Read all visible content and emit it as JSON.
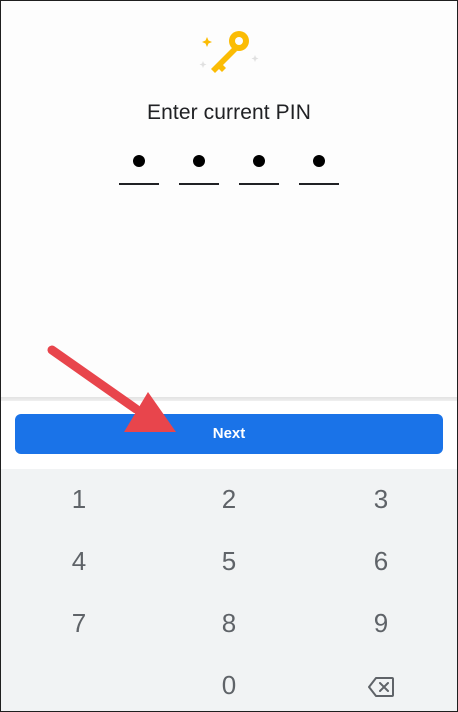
{
  "screen": {
    "title": "Enter current PIN",
    "pin_digits": [
      "●",
      "●",
      "●",
      "●"
    ]
  },
  "next_button": {
    "label": "Next"
  },
  "keypad": {
    "keys": [
      "1",
      "2",
      "3",
      "4",
      "5",
      "6",
      "7",
      "8",
      "9",
      "0"
    ],
    "backspace_icon": "backspace-icon"
  },
  "colors": {
    "accent": "#1a73e8",
    "key_icon": "#fbbc04",
    "annotation_arrow": "#e8454c",
    "keypad_bg": "#f1f3f4"
  }
}
